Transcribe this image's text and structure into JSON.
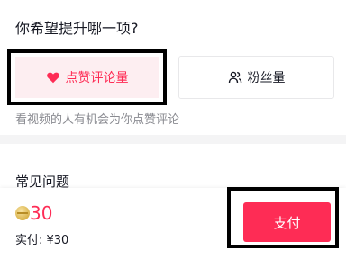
{
  "question": "你希望提升哪一项?",
  "options": [
    {
      "label": "点赞评论量",
      "icon": "heart-icon",
      "selected": true
    },
    {
      "label": "粉丝量",
      "icon": "users-icon",
      "selected": false
    }
  ],
  "hint": "看视频的人有机会为你点赞评论",
  "faq_title": "常见问题",
  "price": "30",
  "paid": "实付: ¥30",
  "pay_label": "支付",
  "colors": {
    "accent": "#fe2c55",
    "selected_bg": "#fdeef1"
  }
}
